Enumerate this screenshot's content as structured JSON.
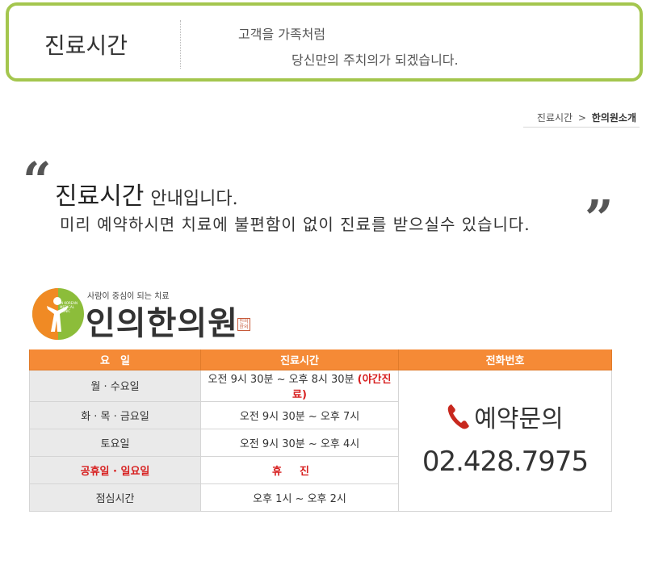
{
  "header": {
    "title": "진료시간",
    "slogan_line1": "고객을 가족처럼",
    "slogan_line2": "당신만의 주치의가 되겠습니다."
  },
  "breadcrumb": {
    "items": [
      "진료시간",
      "한의원소개"
    ],
    "separator": ">"
  },
  "intro": {
    "strong": "진료시간",
    "rest": "안내입니다.",
    "line2": "미리 예약하시면 치료에 불편함이 없이 진료를 받으실수 있습니다.",
    "quote_open": "“",
    "quote_close": "”"
  },
  "logo": {
    "tagline": "사람이 중심이 되는 치료",
    "name": "인의한의원",
    "small_text": "IN KOREAN MEDICAL CLINIC",
    "seal": "인의 한의"
  },
  "table": {
    "headers": [
      "요　일",
      "진료시간",
      "전화번호"
    ],
    "rows": [
      {
        "day": "월 · 수요일",
        "time": "오전 9시 30분 ~ 오후 8시 30분",
        "note": "(야간진료)"
      },
      {
        "day": "화 · 목 · 금요일",
        "time": "오전 9시 30분 ~ 오후 7시"
      },
      {
        "day": "토요일",
        "time": "오전 9시 30분 ~ 오후 4시"
      },
      {
        "day": "공휴일 · 일요일",
        "time": "휴진"
      },
      {
        "day": "점심시간",
        "time": "오후 1시 ~ 오후 2시"
      }
    ],
    "reserve_label": "예약문의",
    "phone": "02.428.7975"
  },
  "colors": {
    "header_border": "#a4c64e",
    "table_header": "#f58a36",
    "highlight_red": "#d71f1f",
    "phone_icon": "#c8281e"
  }
}
